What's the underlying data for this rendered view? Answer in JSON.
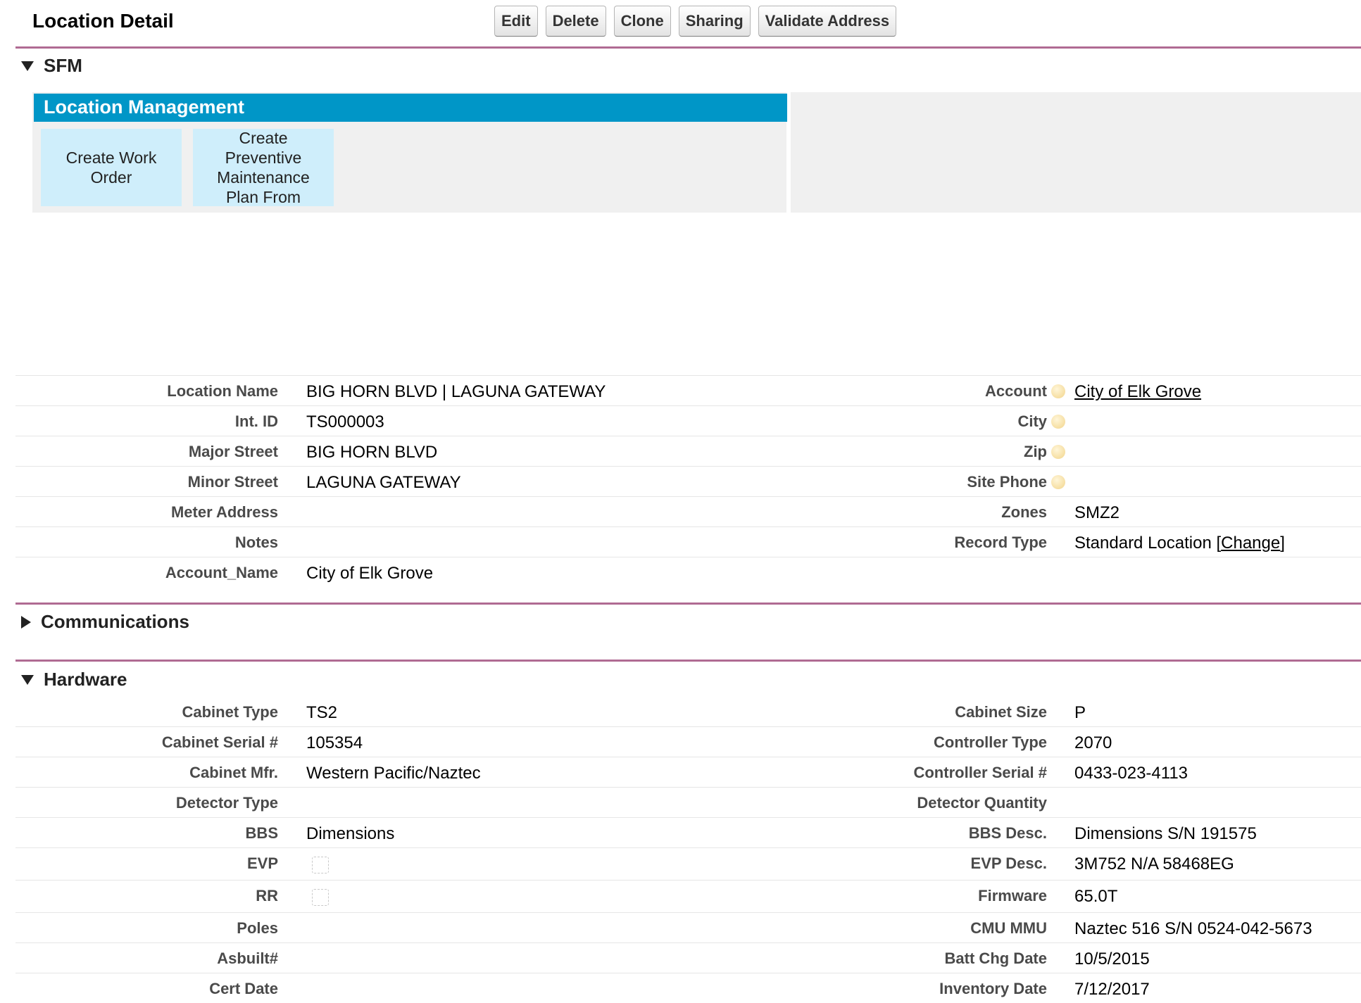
{
  "header": {
    "title": "Location Detail",
    "buttons": [
      "Edit",
      "Delete",
      "Clone",
      "Sharing",
      "Validate Address"
    ]
  },
  "sections": {
    "sfm": "SFM",
    "communications": "Communications",
    "hardware": "Hardware"
  },
  "location_management": {
    "title": "Location Management",
    "tiles": [
      "Create Work Order",
      "Create Preventive Maintenance Plan From"
    ]
  },
  "detail": {
    "location_name_label": "Location Name",
    "location_name": "BIG HORN BLVD | LAGUNA GATEWAY",
    "int_id_label": "Int. ID",
    "int_id": "TS000003",
    "major_street_label": "Major Street",
    "major_street": "BIG HORN BLVD",
    "minor_street_label": "Minor Street",
    "minor_street": "LAGUNA GATEWAY",
    "meter_address_label": "Meter Address",
    "meter_address": "",
    "notes_label": "Notes",
    "notes": "",
    "account_name_label": "Account_Name",
    "account_name": "City of Elk Grove",
    "account_label": "Account",
    "account": "City of Elk Grove",
    "city_label": "City",
    "city": "",
    "zip_label": "Zip",
    "zip": "",
    "site_phone_label": "Site Phone",
    "site_phone": "",
    "zones_label": "Zones",
    "zones": "SMZ2",
    "record_type_label": "Record Type",
    "record_type": "Standard Location",
    "record_type_change": "Change"
  },
  "hardware": {
    "cabinet_type_label": "Cabinet Type",
    "cabinet_type": "TS2",
    "cabinet_serial_label": "Cabinet Serial #",
    "cabinet_serial": "105354",
    "cabinet_mfr_label": "Cabinet Mfr.",
    "cabinet_mfr": "Western Pacific/Naztec",
    "detector_type_label": "Detector Type",
    "detector_type": "",
    "bbs_label": "BBS",
    "bbs": "Dimensions",
    "evp_label": "EVP",
    "evp": false,
    "rr_label": "RR",
    "rr": false,
    "poles_label": "Poles",
    "poles": "",
    "asbuilt_label": "Asbuilt#",
    "asbuilt": "",
    "cert_date_label": "Cert Date",
    "cert_date": "",
    "cabinet_size_label": "Cabinet Size",
    "cabinet_size": "P",
    "controller_type_label": "Controller Type",
    "controller_type": "2070",
    "controller_serial_label": "Controller Serial #",
    "controller_serial": "0433-023-4113",
    "detector_quantity_label": "Detector Quantity",
    "detector_quantity": "",
    "bbs_desc_label": "BBS Desc.",
    "bbs_desc": "Dimensions S/N 191575",
    "evp_desc_label": "EVP Desc.",
    "evp_desc": "3M752 N/A 58468EG",
    "firmware_label": "Firmware",
    "firmware": "65.0T",
    "cmu_mmu_label": "CMU MMU",
    "cmu_mmu": "Naztec 516 S/N 0524-042-5673",
    "batt_chg_date_label": "Batt Chg Date",
    "batt_chg_date": "10/5/2015",
    "inventory_date_label": "Inventory Date",
    "inventory_date": "7/12/2017"
  },
  "colors": {
    "accent_rule": "#b06b93",
    "lm_header": "#0096c7",
    "tile_bg": "#cfeefb"
  }
}
